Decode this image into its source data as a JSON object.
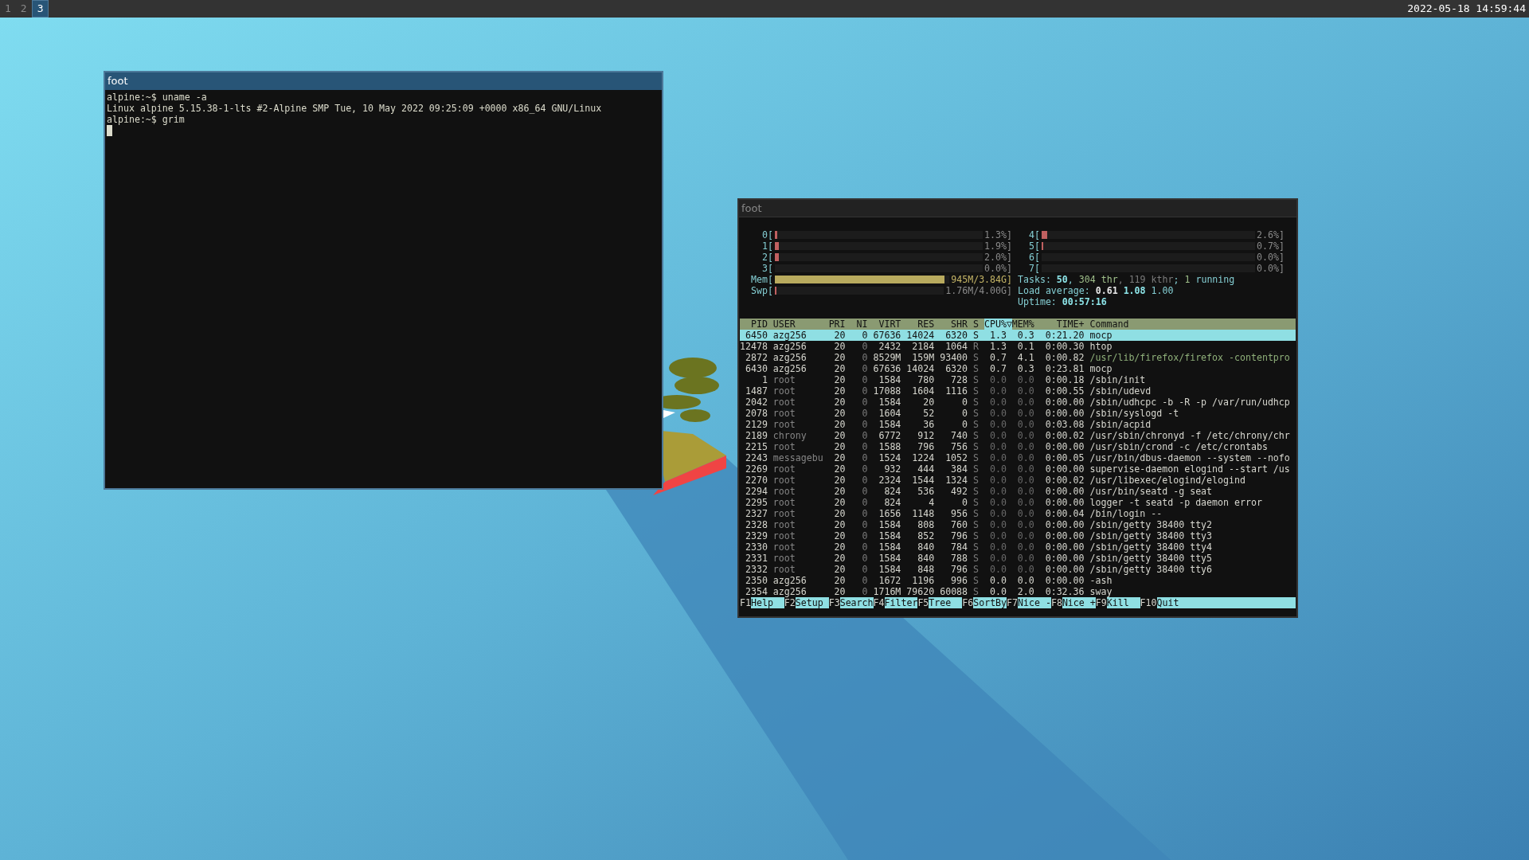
{
  "top_bar": {
    "workspaces": [
      {
        "label": "1",
        "selected": false
      },
      {
        "label": "2",
        "selected": false
      },
      {
        "label": "3",
        "selected": true
      }
    ],
    "clock": "2022-05-18 14:59:44"
  },
  "terminal_window": {
    "title": "foot",
    "lines": [
      "alpine:~$ uname -a",
      "Linux alpine 5.15.38-1-lts #2-Alpine SMP Tue, 10 May 2022 09:25:09 +0000 x86_64 GNU/Linux",
      "alpine:~$ grim"
    ]
  },
  "htop_window": {
    "title": "foot",
    "meters_left": [
      {
        "label": "0[",
        "kind": "cpu",
        "level": 0.013,
        "reading": "1.3%]"
      },
      {
        "label": "1[",
        "kind": "cpu",
        "level": 0.019,
        "reading": "1.9%]"
      },
      {
        "label": "2[",
        "kind": "cpu",
        "level": 0.02,
        "reading": "2.0%]"
      },
      {
        "label": "3[",
        "kind": "cpu",
        "reading": "0.0%]"
      },
      {
        "label": "Mem[",
        "kind": "memory",
        "level": 0.97,
        "reading": "945M/3.84G]"
      },
      {
        "label": "Swp[",
        "kind": "swap",
        "level": 0.01,
        "reading": "1.76M/4.00G]"
      }
    ],
    "meters_right": [
      {
        "label": "4[",
        "kind": "cpu",
        "level": 0.026,
        "reading": "2.6%]"
      },
      {
        "label": "5[",
        "kind": "cpu",
        "level": 0.007,
        "reading": "0.7%]"
      },
      {
        "label": "6[",
        "kind": "cpu",
        "reading": "0.0%]"
      },
      {
        "label": "7[",
        "kind": "cpu",
        "reading": "0.0%]"
      }
    ],
    "tasks": [
      {
        "text": "Tasks: ",
        "kind": "label"
      },
      {
        "text": "50",
        "kind": "value"
      },
      {
        "text": ", ",
        "kind": "label"
      },
      {
        "text": "304 thr",
        "kind": "green"
      },
      {
        "text": ", ",
        "kind": "dim"
      },
      {
        "text": "119 kthr",
        "kind": "dim"
      },
      {
        "text": "; ",
        "kind": "label"
      },
      {
        "text": "1",
        "kind": "green"
      },
      {
        "text": " running",
        "kind": "label"
      }
    ],
    "load_average": [
      {
        "text": "Load average: ",
        "kind": "label"
      },
      {
        "text": "0.61 ",
        "kind": "strong"
      },
      {
        "text": "1.08 ",
        "kind": "value"
      },
      {
        "text": "1.00",
        "kind": "label"
      }
    ],
    "uptime": [
      {
        "text": "Uptime: ",
        "kind": "label"
      },
      {
        "text": "00:57:16",
        "kind": "value"
      }
    ],
    "table": {
      "columns": [
        {
          "label": "PID",
          "selected": false
        },
        {
          "label": "USER",
          "selected": false
        },
        {
          "label": "PRI",
          "selected": false
        },
        {
          "label": "NI",
          "selected": false
        },
        {
          "label": "VIRT",
          "selected": false
        },
        {
          "label": "RES",
          "selected": false
        },
        {
          "label": "SHR",
          "selected": false
        },
        {
          "label": "S",
          "selected": false
        },
        {
          "label": "CPU%▽",
          "selected": true
        },
        {
          "label": "MEM%",
          "selected": false
        },
        {
          "label": "TIME+",
          "selected": false
        },
        {
          "label": "Command",
          "selected": false
        }
      ],
      "rows": [
        {
          "cells": [
            "6450",
            "azg256",
            "20",
            "0",
            "67636",
            "14024",
            "6320",
            "S",
            "1.3",
            "0.3",
            "0:21.20",
            "mocp"
          ],
          "selected": true,
          "system": false,
          "kind": "process"
        },
        {
          "cells": [
            "12478",
            "azg256",
            "20",
            "0",
            "2432",
            "2184",
            "1064",
            "R",
            "1.3",
            "0.1",
            "0:00.30",
            "htop"
          ],
          "selected": false,
          "system": false,
          "kind": "process"
        },
        {
          "cells": [
            "2872",
            "azg256",
            "20",
            "0",
            "8529M",
            "159M",
            "93400",
            "S",
            "0.7",
            "4.1",
            "0:00.82",
            "/usr/lib/firefox/firefox -contentpro"
          ],
          "selected": false,
          "system": false,
          "kind": "thread"
        },
        {
          "cells": [
            "6430",
            "azg256",
            "20",
            "0",
            "67636",
            "14024",
            "6320",
            "S",
            "0.7",
            "0.3",
            "0:23.81",
            "mocp"
          ],
          "selected": false,
          "system": false,
          "kind": "process"
        },
        {
          "cells": [
            "1",
            "root",
            "20",
            "0",
            "1584",
            "780",
            "728",
            "S",
            "0.0",
            "0.0",
            "0:00.18",
            "/sbin/init"
          ],
          "selected": false,
          "system": true,
          "kind": "process"
        },
        {
          "cells": [
            "1487",
            "root",
            "20",
            "0",
            "17088",
            "1604",
            "1116",
            "S",
            "0.0",
            "0.0",
            "0:00.55",
            "/sbin/udevd"
          ],
          "selected": false,
          "system": true,
          "kind": "process"
        },
        {
          "cells": [
            "2042",
            "root",
            "20",
            "0",
            "1584",
            "20",
            "0",
            "S",
            "0.0",
            "0.0",
            "0:00.00",
            "/sbin/udhcpc -b -R -p /var/run/udhcp"
          ],
          "selected": false,
          "system": true,
          "kind": "process"
        },
        {
          "cells": [
            "2078",
            "root",
            "20",
            "0",
            "1604",
            "52",
            "0",
            "S",
            "0.0",
            "0.0",
            "0:00.00",
            "/sbin/syslogd -t"
          ],
          "selected": false,
          "system": true,
          "kind": "process"
        },
        {
          "cells": [
            "2129",
            "root",
            "20",
            "0",
            "1584",
            "36",
            "0",
            "S",
            "0.0",
            "0.0",
            "0:03.08",
            "/sbin/acpid"
          ],
          "selected": false,
          "system": true,
          "kind": "process"
        },
        {
          "cells": [
            "2189",
            "chrony",
            "20",
            "0",
            "6772",
            "912",
            "740",
            "S",
            "0.0",
            "0.0",
            "0:00.02",
            "/usr/sbin/chronyd -f /etc/chrony/chr"
          ],
          "selected": false,
          "system": true,
          "kind": "process"
        },
        {
          "cells": [
            "2215",
            "root",
            "20",
            "0",
            "1588",
            "796",
            "756",
            "S",
            "0.0",
            "0.0",
            "0:00.00",
            "/usr/sbin/crond -c /etc/crontabs"
          ],
          "selected": false,
          "system": true,
          "kind": "process"
        },
        {
          "cells": [
            "2243",
            "messagebu",
            "20",
            "0",
            "1524",
            "1224",
            "1052",
            "S",
            "0.0",
            "0.0",
            "0:00.05",
            "/usr/bin/dbus-daemon --system --nofo"
          ],
          "selected": false,
          "system": true,
          "kind": "process"
        },
        {
          "cells": [
            "2269",
            "root",
            "20",
            "0",
            "932",
            "444",
            "384",
            "S",
            "0.0",
            "0.0",
            "0:00.00",
            "supervise-daemon elogind --start /us"
          ],
          "selected": false,
          "system": true,
          "kind": "process"
        },
        {
          "cells": [
            "2270",
            "root",
            "20",
            "0",
            "2324",
            "1544",
            "1324",
            "S",
            "0.0",
            "0.0",
            "0:00.02",
            "/usr/libexec/elogind/elogind"
          ],
          "selected": false,
          "system": true,
          "kind": "process"
        },
        {
          "cells": [
            "2294",
            "root",
            "20",
            "0",
            "824",
            "536",
            "492",
            "S",
            "0.0",
            "0.0",
            "0:00.00",
            "/usr/bin/seatd -g seat"
          ],
          "selected": false,
          "system": true,
          "kind": "process"
        },
        {
          "cells": [
            "2295",
            "root",
            "20",
            "0",
            "824",
            "4",
            "0",
            "S",
            "0.0",
            "0.0",
            "0:00.00",
            "logger -t seatd -p daemon error"
          ],
          "selected": false,
          "system": true,
          "kind": "process"
        },
        {
          "cells": [
            "2327",
            "root",
            "20",
            "0",
            "1656",
            "1148",
            "956",
            "S",
            "0.0",
            "0.0",
            "0:00.04",
            "/bin/login --"
          ],
          "selected": false,
          "system": true,
          "kind": "process"
        },
        {
          "cells": [
            "2328",
            "root",
            "20",
            "0",
            "1584",
            "808",
            "760",
            "S",
            "0.0",
            "0.0",
            "0:00.00",
            "/sbin/getty 38400 tty2"
          ],
          "selected": false,
          "system": true,
          "kind": "process"
        },
        {
          "cells": [
            "2329",
            "root",
            "20",
            "0",
            "1584",
            "852",
            "796",
            "S",
            "0.0",
            "0.0",
            "0:00.00",
            "/sbin/getty 38400 tty3"
          ],
          "selected": false,
          "system": true,
          "kind": "process"
        },
        {
          "cells": [
            "2330",
            "root",
            "20",
            "0",
            "1584",
            "840",
            "784",
            "S",
            "0.0",
            "0.0",
            "0:00.00",
            "/sbin/getty 38400 tty4"
          ],
          "selected": false,
          "system": true,
          "kind": "process"
        },
        {
          "cells": [
            "2331",
            "root",
            "20",
            "0",
            "1584",
            "840",
            "788",
            "S",
            "0.0",
            "0.0",
            "0:00.00",
            "/sbin/getty 38400 tty5"
          ],
          "selected": false,
          "system": true,
          "kind": "process"
        },
        {
          "cells": [
            "2332",
            "root",
            "20",
            "0",
            "1584",
            "848",
            "796",
            "S",
            "0.0",
            "0.0",
            "0:00.00",
            "/sbin/getty 38400 tty6"
          ],
          "selected": false,
          "system": true,
          "kind": "process"
        },
        {
          "cells": [
            "2350",
            "azg256",
            "20",
            "0",
            "1672",
            "1196",
            "996",
            "S",
            "0.0",
            "0.0",
            "0:00.00",
            "-ash"
          ],
          "selected": false,
          "system": false,
          "kind": "process"
        },
        {
          "cells": [
            "2354",
            "azg256",
            "20",
            "0",
            "1716M",
            "79620",
            "60088",
            "S",
            "0.0",
            "2.0",
            "0:32.36",
            "sway"
          ],
          "selected": false,
          "system": false,
          "kind": "process"
        }
      ]
    },
    "function_keys": [
      {
        "key": "F1",
        "label": "Help"
      },
      {
        "key": "F2",
        "label": "Setup"
      },
      {
        "key": "F3",
        "label": "Search"
      },
      {
        "key": "F4",
        "label": "Filter"
      },
      {
        "key": "F5",
        "label": "Tree"
      },
      {
        "key": "F6",
        "label": "SortBy"
      },
      {
        "key": "F7",
        "label": "Nice -"
      },
      {
        "key": "F8",
        "label": "Nice +"
      },
      {
        "key": "F9",
        "label": "Kill"
      },
      {
        "key": "F10",
        "label": "Quit"
      }
    ]
  }
}
